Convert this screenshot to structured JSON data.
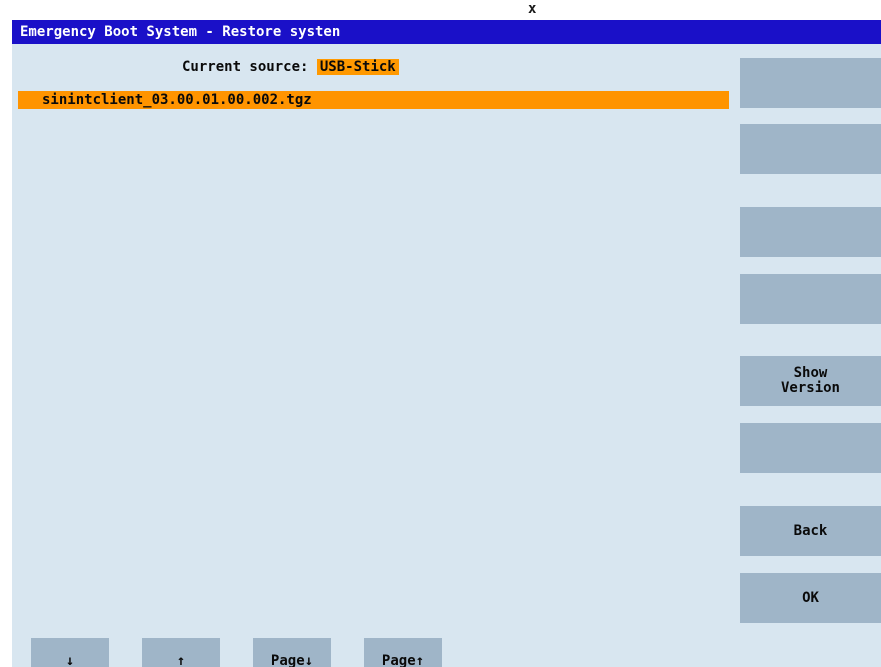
{
  "top_marker": "x",
  "title": "Emergency Boot System - Restore systen",
  "source": {
    "label": "Current source:",
    "value": "USB-Stick"
  },
  "files": [
    "sinintclient_03.00.01.00.002.tgz"
  ],
  "vertical_softkeys": [
    "",
    "",
    "",
    "",
    "Show\nVersion",
    "",
    "Back",
    "OK"
  ],
  "horizontal_softkeys": [
    "↓",
    "↑",
    "Page↓",
    "Page↑"
  ],
  "colors": {
    "titlebar": "#1a10c8",
    "background": "#d8e6f0",
    "highlight": "#ff9400",
    "softkey": "#9fb5c8"
  }
}
